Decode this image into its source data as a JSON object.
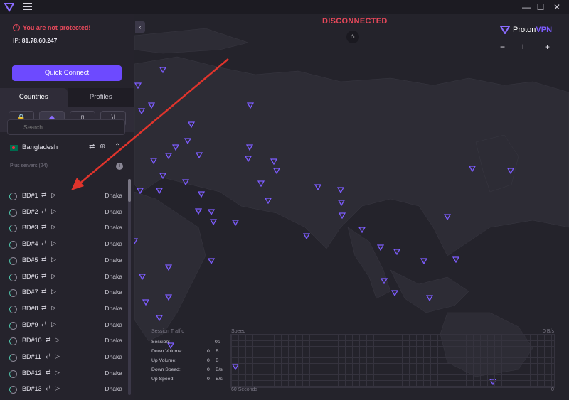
{
  "window": {
    "minimize": "—",
    "maximize": "☐",
    "close": "✕"
  },
  "status": {
    "warning": "You are not protected!",
    "ip_label": "IP:",
    "ip": "81.78.60.247"
  },
  "quick_connect": "Quick Connect",
  "tabs": {
    "countries": "Countries",
    "profiles": "Profiles"
  },
  "filters": [
    "🔒",
    "◆",
    "▯",
    "⟩|"
  ],
  "search": {
    "placeholder": "Search"
  },
  "country": {
    "name": "Bangladesh"
  },
  "plus_servers": "Plus servers (24)",
  "servers": [
    {
      "name": "BD#1",
      "city": "Dhaka"
    },
    {
      "name": "BD#2",
      "city": "Dhaka"
    },
    {
      "name": "BD#3",
      "city": "Dhaka"
    },
    {
      "name": "BD#4",
      "city": "Dhaka"
    },
    {
      "name": "BD#5",
      "city": "Dhaka"
    },
    {
      "name": "BD#6",
      "city": "Dhaka"
    },
    {
      "name": "BD#7",
      "city": "Dhaka"
    },
    {
      "name": "BD#8",
      "city": "Dhaka"
    },
    {
      "name": "BD#9",
      "city": "Dhaka"
    },
    {
      "name": "BD#10",
      "city": "Dhaka"
    },
    {
      "name": "BD#11",
      "city": "Dhaka"
    },
    {
      "name": "BD#12",
      "city": "Dhaka"
    },
    {
      "name": "BD#13",
      "city": "Dhaka"
    }
  ],
  "map": {
    "status": "DISCONNECTED",
    "brand_prefix": "Proton",
    "brand_suffix": "VPN",
    "zoom_out": "−",
    "zoom_in": "+",
    "zoom_mid": "I"
  },
  "traffic": {
    "title": "Session Traffic",
    "speed_label": "Speed",
    "speed_max": "0 B/s",
    "time_label": "60 Seconds",
    "rows": [
      {
        "label": "Session:",
        "value": "0s",
        "unit": ""
      },
      {
        "label": "Down Volume:",
        "value": "0",
        "unit": "B"
      },
      {
        "label": "Up Volume:",
        "value": "0",
        "unit": "B"
      },
      {
        "label": "Down Speed:",
        "value": "0",
        "unit": "B/s"
      },
      {
        "label": "Up Speed:",
        "value": "0",
        "unit": "B/s"
      }
    ]
  },
  "colors": {
    "accent": "#6d4aff",
    "danger": "#e6485a",
    "pin": "#7d5cff"
  }
}
